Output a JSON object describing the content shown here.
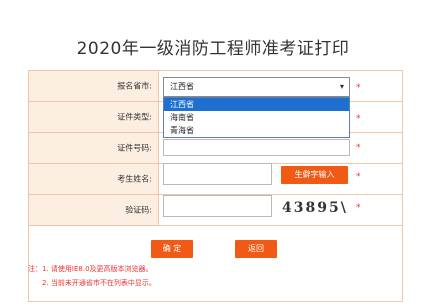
{
  "page": {
    "title": "2020年一级消防工程师准考证打印"
  },
  "form": {
    "province_label": "报名省市:",
    "province_selected": "江西省",
    "province_options": [
      "江西省",
      "海南省",
      "青海省"
    ],
    "id_type_label": "证件类型:",
    "id_number_label": "证件号码:",
    "name_label": "考生姓名:",
    "rare_char_button": "生僻字输入",
    "captcha_label": "验证码:",
    "captcha_text": "43895\\",
    "required_mark": "*"
  },
  "buttons": {
    "confirm": "确 定",
    "back": "返回"
  },
  "notes": {
    "line1": "注：1. 请使用IE8.0及更高版本浏览器。",
    "line2": "2. 当前未开通省市不在列表中显示。"
  },
  "colors": {
    "accent": "#f05a14",
    "label_bg": "#fdeee2",
    "border": "#f0c6a8",
    "required": "#e33333"
  }
}
